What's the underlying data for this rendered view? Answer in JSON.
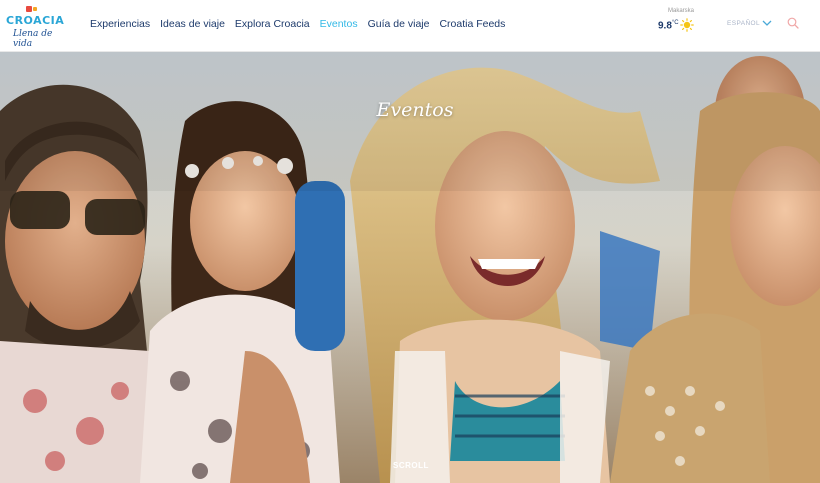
{
  "brand": {
    "logo_word": "CROACIA",
    "logo_tagline": "Llena de vida"
  },
  "nav": {
    "items": [
      {
        "label": "Experiencias",
        "active": false
      },
      {
        "label": "Ideas de viaje",
        "active": false
      },
      {
        "label": "Explora Croacia",
        "active": false
      },
      {
        "label": "Eventos",
        "active": true
      },
      {
        "label": "Guía de viaje",
        "active": false
      },
      {
        "label": "Croatia Feeds",
        "active": false
      }
    ]
  },
  "weather": {
    "city": "Makarska",
    "temperature": "9.8",
    "unit": "°C",
    "icon": "sun-icon"
  },
  "language": {
    "selected": "ESPAÑOL"
  },
  "hero": {
    "title": "Eventos",
    "scroll_label": "SCROLL"
  },
  "colors": {
    "nav_text": "#1d3a6b",
    "nav_active": "#32b8e6",
    "accent_sun": "#f5c518"
  }
}
